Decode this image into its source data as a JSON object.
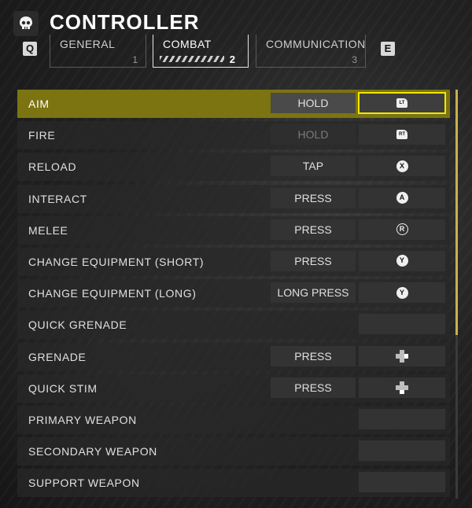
{
  "header": {
    "title": "CONTROLLER",
    "logo_icon": "skull-icon"
  },
  "tab_keys": {
    "prev": "Q",
    "next": "E"
  },
  "tabs": [
    {
      "label": "GENERAL",
      "number": "1",
      "selected": false
    },
    {
      "label": "COMBAT",
      "number": "2",
      "selected": true
    },
    {
      "label": "COMMUNICATION",
      "number": "3",
      "selected": false
    }
  ],
  "rows": [
    {
      "label": "AIM",
      "mode": "HOLD",
      "button": "LT",
      "button_icon": "left-trigger-icon",
      "active": true
    },
    {
      "label": "FIRE",
      "mode": "HOLD",
      "button": "RT",
      "button_icon": "right-trigger-icon",
      "mode_disabled": true
    },
    {
      "label": "RELOAD",
      "mode": "TAP",
      "button": "X",
      "button_icon": "x-button-icon"
    },
    {
      "label": "INTERACT",
      "mode": "PRESS",
      "button": "A",
      "button_icon": "a-button-icon"
    },
    {
      "label": "MELEE",
      "mode": "PRESS",
      "button": "R",
      "button_icon": "right-stick-icon"
    },
    {
      "label": "CHANGE EQUIPMENT (SHORT)",
      "mode": "PRESS",
      "button": "Y",
      "button_icon": "y-button-icon"
    },
    {
      "label": "CHANGE EQUIPMENT (LONG)",
      "mode": "LONG PRESS",
      "button": "Y",
      "button_icon": "y-button-icon"
    },
    {
      "label": "QUICK GRENADE",
      "mode": "",
      "button": "",
      "button_icon": ""
    },
    {
      "label": "GRENADE",
      "mode": "PRESS",
      "button": "",
      "button_icon": "dpad-right-icon"
    },
    {
      "label": "QUICK STIM",
      "mode": "PRESS",
      "button": "",
      "button_icon": "dpad-down-icon"
    },
    {
      "label": "PRIMARY WEAPON",
      "mode": "",
      "button": "",
      "button_icon": ""
    },
    {
      "label": "SECONDARY WEAPON",
      "mode": "",
      "button": "",
      "button_icon": ""
    },
    {
      "label": "SUPPORT WEAPON",
      "mode": "",
      "button": "",
      "button_icon": ""
    }
  ],
  "colors": {
    "highlight": "#f2e700",
    "active_row": "#7b7410"
  }
}
